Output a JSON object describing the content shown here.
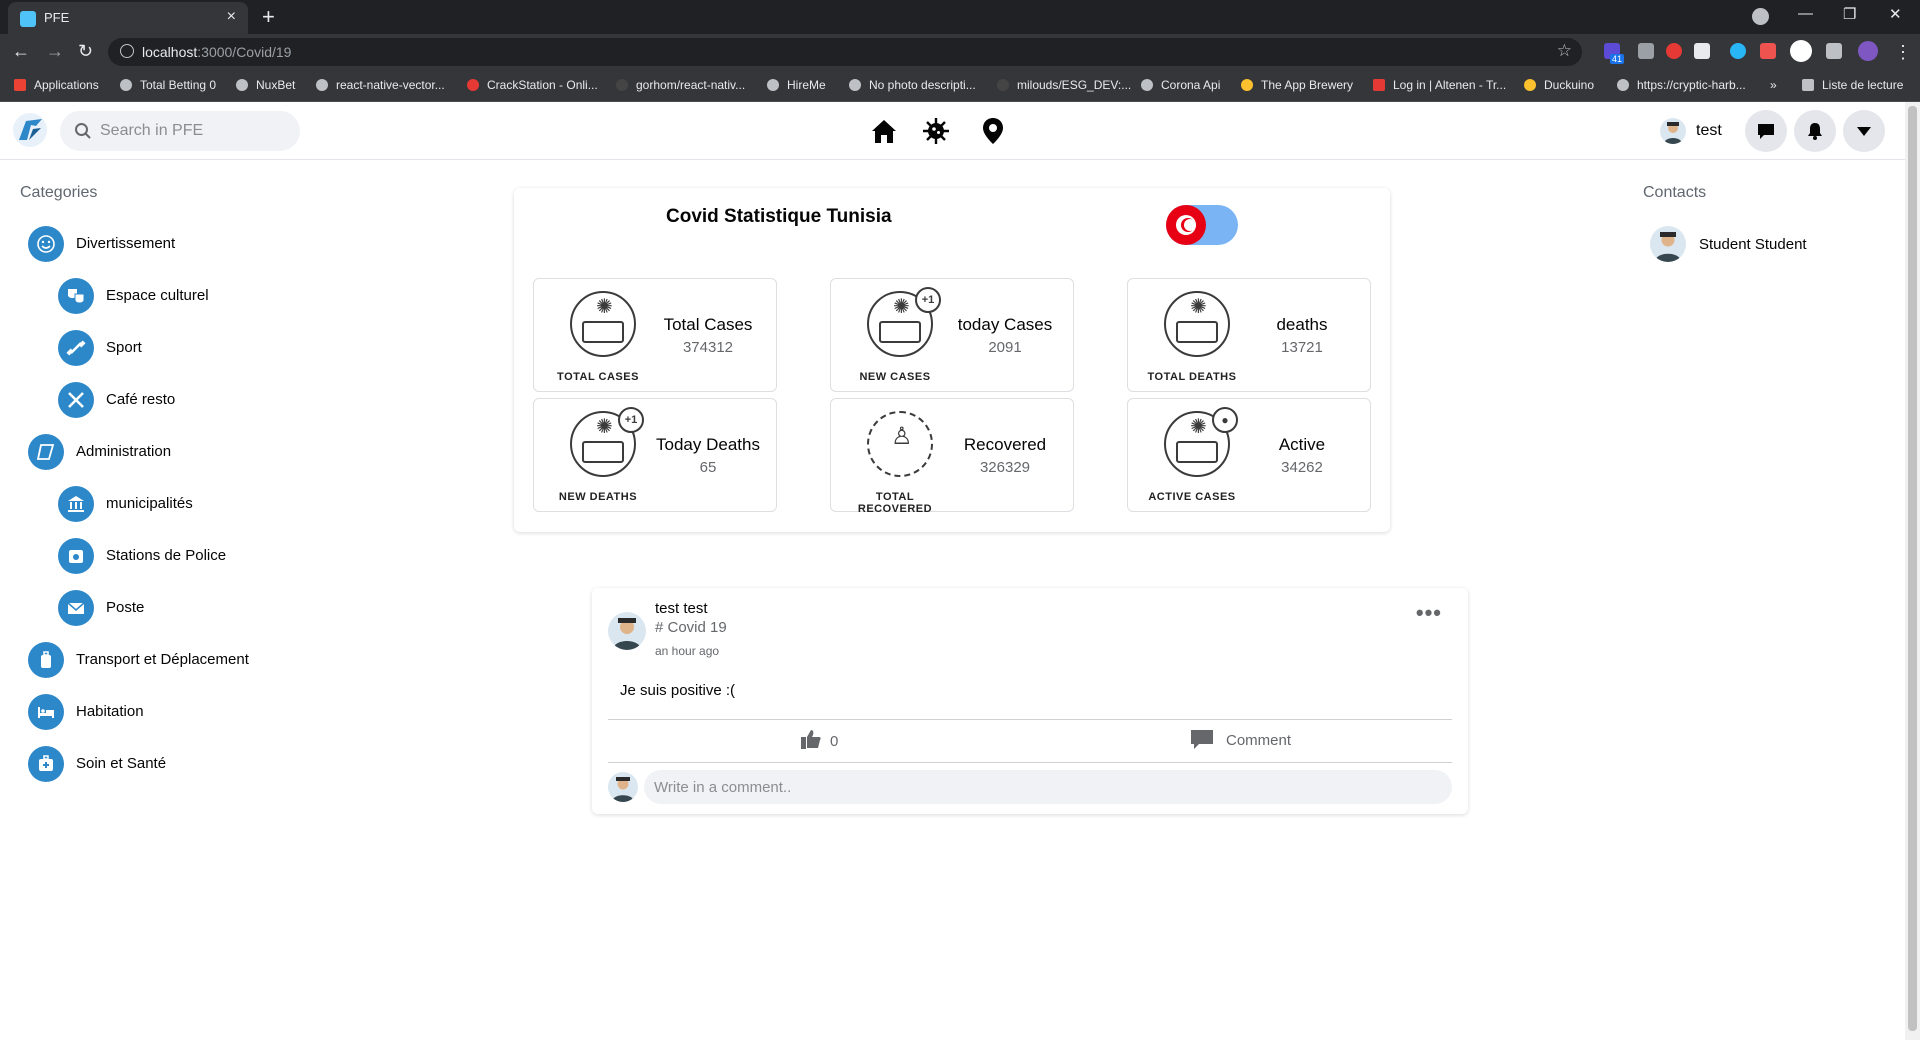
{
  "browser": {
    "tab_title": "PFE",
    "url_host": "localhost",
    "url_path": ":3000/Covid/19",
    "bookmarks": [
      "Applications",
      "Total Betting 0",
      "NuxBet",
      "react-native-vector...",
      "CrackStation - Onli...",
      "gorhom/react-nativ...",
      "HireMe",
      "No photo descripti...",
      "milouds/ESG_DEV:...",
      "Corona Api",
      "The App Brewery",
      "Log in | Altenen - Tr...",
      "Duckuino",
      "https://cryptic-harb...",
      "»",
      "Liste de lecture"
    ],
    "extension_badge": "41"
  },
  "header": {
    "search_placeholder": "Search in PFE",
    "user_name": "test"
  },
  "sidebar": {
    "title": "Categories",
    "items": [
      {
        "label": "Divertissement",
        "icon": "smile-icon",
        "level": 0
      },
      {
        "label": "Espace culturel",
        "icon": "theater-masks-icon",
        "level": 1
      },
      {
        "label": "Sport",
        "icon": "dumbbell-icon",
        "level": 1
      },
      {
        "label": "Café resto",
        "icon": "utensils-icon",
        "level": 1
      },
      {
        "label": "Administration",
        "icon": "building-icon",
        "level": 0
      },
      {
        "label": "municipalités",
        "icon": "city-hall-icon",
        "level": 1
      },
      {
        "label": "Stations de Police",
        "icon": "police-icon",
        "level": 1
      },
      {
        "label": "Poste",
        "icon": "mail-icon",
        "level": 1
      },
      {
        "label": "Transport et Déplacement",
        "icon": "luggage-icon",
        "level": 0
      },
      {
        "label": "Habitation",
        "icon": "bed-icon",
        "level": 0
      },
      {
        "label": "Soin et Santé",
        "icon": "medical-kit-icon",
        "level": 0
      }
    ]
  },
  "stats": {
    "title": "Covid Statistique Tunisia",
    "cards": [
      {
        "label": "Total Cases",
        "value": "374312",
        "caption": "TOTAL CASES",
        "badge": false
      },
      {
        "label": "today Cases",
        "value": "2091",
        "caption": "NEW CASES",
        "badge": true
      },
      {
        "label": "deaths",
        "value": "13721",
        "caption": "TOTAL DEATHS",
        "badge": false
      },
      {
        "label": "Today Deaths",
        "value": "65",
        "caption": "NEW DEATHS",
        "badge": true
      },
      {
        "label": "Recovered",
        "value": "326329",
        "caption": "TOTAL RECOVERED",
        "badge": false
      },
      {
        "label": "Active",
        "value": "34262",
        "caption": "ACTIVE CASES",
        "badge": false
      }
    ]
  },
  "post": {
    "author": "test test",
    "tag": "# Covid 19",
    "time": "an hour ago",
    "text": "Je suis positive :(",
    "likes": "0",
    "comment_label": "Comment",
    "comment_placeholder": "Write in a comment.."
  },
  "contacts": {
    "title": "Contacts",
    "items": [
      {
        "name": "Student Student"
      }
    ]
  },
  "colors": {
    "accent": "#2d88c9",
    "toggle_track": "#7ab4f5",
    "flag_red": "#e70013"
  }
}
